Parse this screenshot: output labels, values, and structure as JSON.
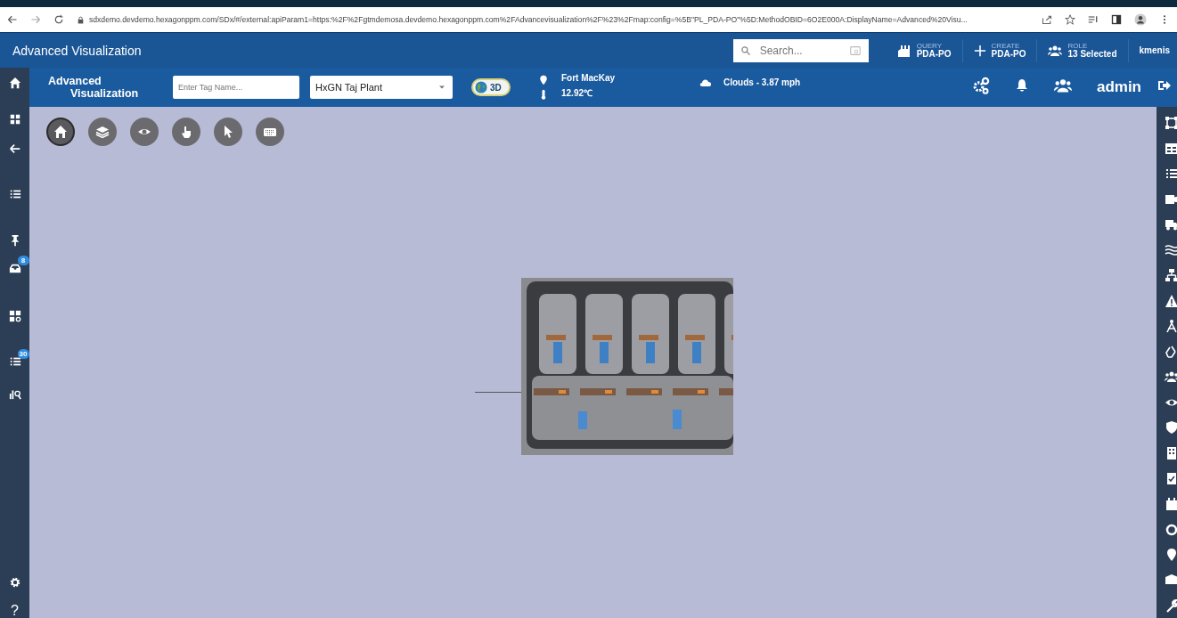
{
  "browser": {
    "url": "sdxdemo.devdemo.hexagonppm.com/SDx/#/external:apiParam1=https:%2F%2Fgtmdemosa.devdemo.hexagonppm.com%2FAdvancevisualization%2F%23%2Fmap:config=%5B\"PL_PDA-PO\"%5D:MethodOBID=6O2E000A:DisplayName=Advanced%20Visu..."
  },
  "header": {
    "title": "Advanced Visualization",
    "search": {
      "placeholder": "Search..."
    },
    "query": {
      "label": "QUERY",
      "value": "PDA-PO"
    },
    "create": {
      "label": "CREATE",
      "value": "PDA-PO"
    },
    "role": {
      "label": "ROLE",
      "value": "13 Selected"
    },
    "user": "kmenis"
  },
  "toolbar": {
    "app_name_line_1": "Advanced",
    "app_name_line_2": "Visualization",
    "tag_field": {
      "placeholder": "Enter Tag Name..."
    },
    "plant_select": {
      "value": "HxGN Taj Plant"
    },
    "view_toggle": {
      "label": "3D"
    },
    "location": "Fort MacKay",
    "temperature": "12.92℃",
    "weather": "Clouds - 3.87 mph",
    "username": "admin"
  },
  "left_sidebar": {
    "inbox_badge": "8",
    "tasks_badge": "30",
    "help": "?"
  },
  "canvas_tools": [
    {
      "selected": true
    },
    {
      "selected": false
    },
    {
      "selected": false
    },
    {
      "selected": false
    },
    {
      "selected": false
    },
    {
      "selected": false
    }
  ]
}
